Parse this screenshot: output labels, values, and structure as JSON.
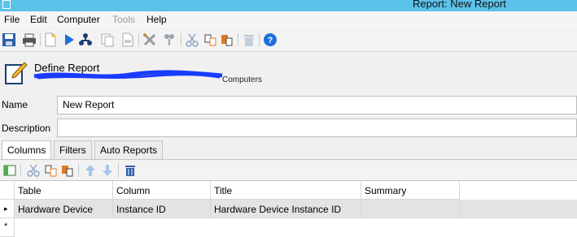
{
  "window": {
    "title": "Report: New Report"
  },
  "menu": {
    "file": "File",
    "edit": "Edit",
    "computer": "Computer",
    "tools": "Tools",
    "help": "Help"
  },
  "header": {
    "title": "Define Report",
    "subtitle": "Computers"
  },
  "form": {
    "name_label": "Name",
    "name_value": "New Report",
    "description_label": "Description",
    "description_value": ""
  },
  "tabs": [
    "Columns",
    "Filters",
    "Auto Reports"
  ],
  "grid": {
    "headers": [
      "Table",
      "Column",
      "Title",
      "Summary"
    ],
    "rows": [
      [
        "Hardware Device",
        "Instance ID",
        "Hardware Device Instance ID",
        ""
      ]
    ],
    "new_row_marker": "*",
    "current_row_marker": "▸"
  },
  "icons": {
    "toolbar": [
      "save-icon",
      "print-icon",
      "new-document-icon",
      "run-icon",
      "hierarchy-icon",
      "copy-page-icon",
      "export-icon",
      "tools-icon",
      "filter-icon",
      "cut-icon",
      "copy-icon",
      "paste-icon",
      "delete-icon",
      "help-icon"
    ],
    "grid_toolbar": [
      "add-column-icon",
      "cut-icon",
      "copy-icon",
      "paste-icon",
      "move-up-icon",
      "move-down-icon",
      "delete-icon"
    ]
  },
  "colors": {
    "titlebar": "#5bc2ea",
    "accent_blue": "#1e6fd9",
    "scribble": "#1a3cff"
  }
}
